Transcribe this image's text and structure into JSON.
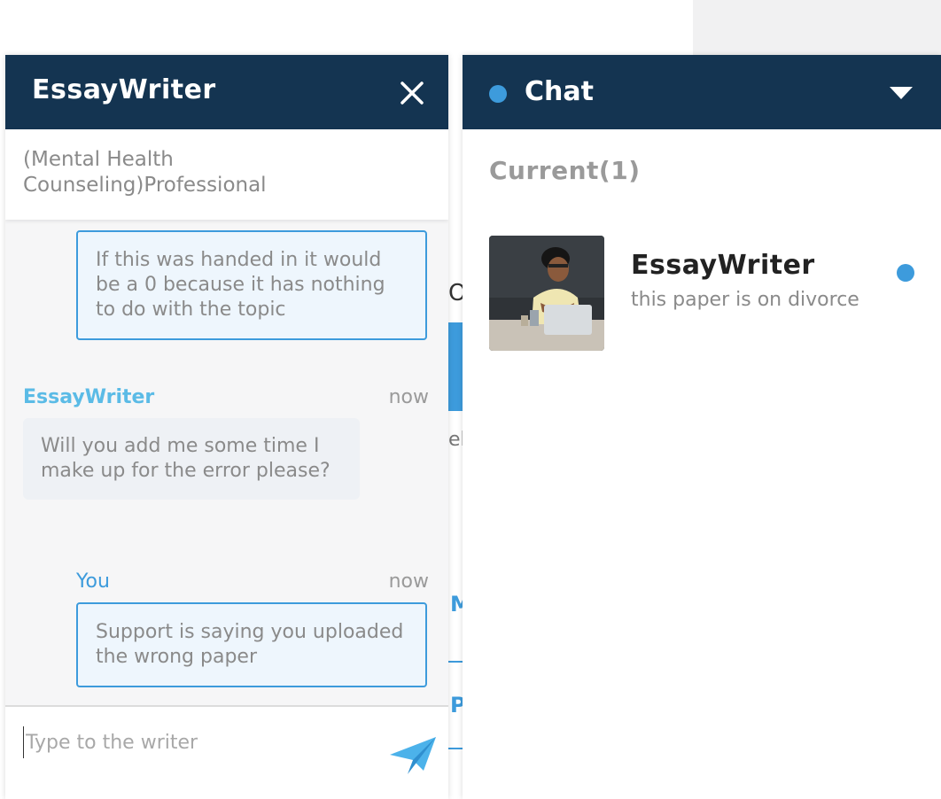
{
  "writer_chat": {
    "title": "EssayWriter",
    "subject": "(Mental Health Counseling)Professional",
    "messages": [
      {
        "direction": "out",
        "text": "If this was handed in it would be a 0 because it has nothing to do with the topic"
      },
      {
        "direction": "in",
        "sender": "EssayWriter",
        "time": "now",
        "text": "Will you add me some time I make up for the error please?"
      },
      {
        "direction": "out",
        "sender": "You",
        "time": "now",
        "text": "Support is saying you uploaded the wrong paper"
      }
    ],
    "input_placeholder": "Type to the writer"
  },
  "chat_list": {
    "title": "Chat",
    "section_label": "Current(1)",
    "conversations": [
      {
        "name": "EssayWriter",
        "preview": "this paper is on divorce",
        "unread": true
      }
    ]
  },
  "colors": {
    "header_bg": "#143451",
    "accent": "#3d9bdc",
    "writer_name": "#5bbbe6"
  },
  "icons": [
    "close-icon",
    "send-icon",
    "caret-down-icon",
    "status-dot",
    "unread-dot"
  ]
}
